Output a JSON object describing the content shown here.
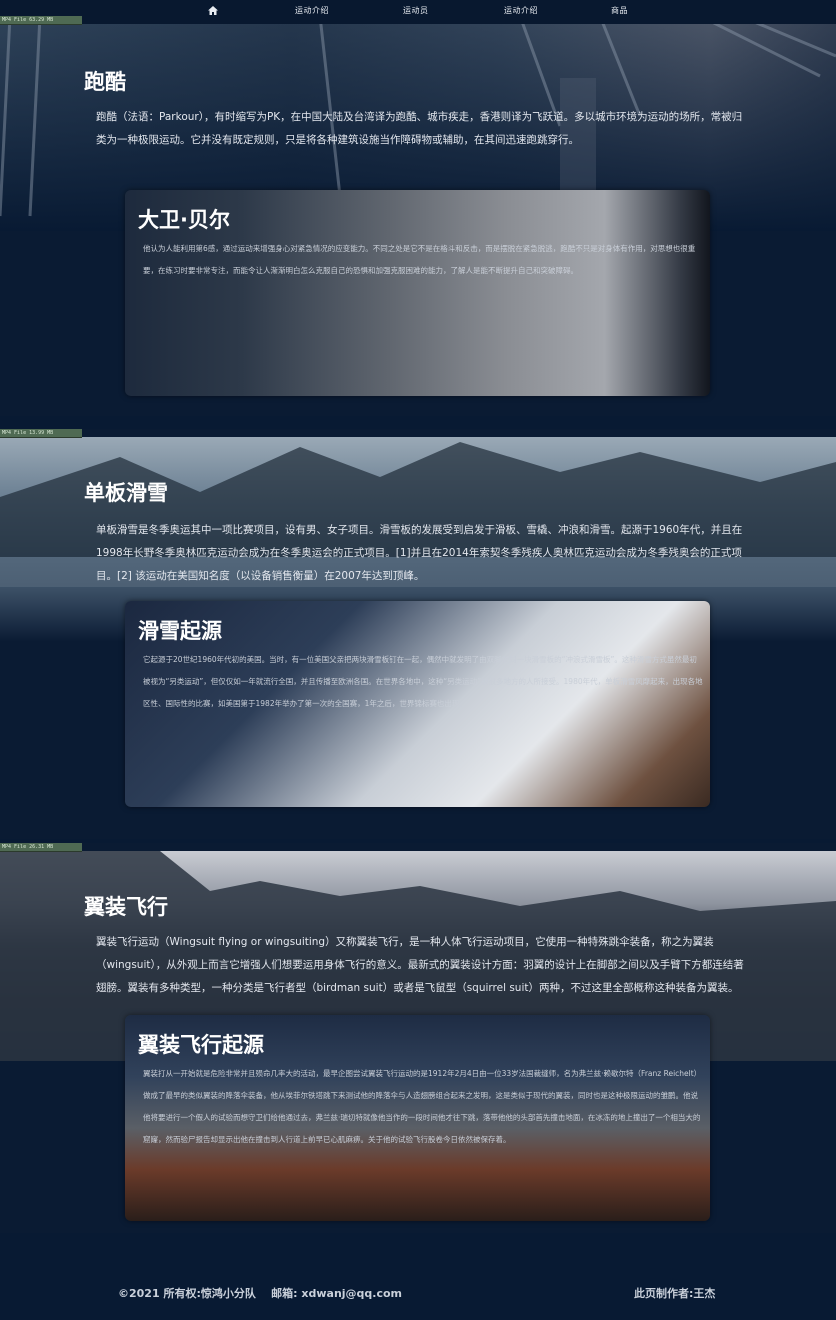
{
  "nav": {
    "items": [
      "运动介绍",
      "运动员",
      "运动介绍",
      "商品"
    ]
  },
  "file_tags": [
    "MP4 File 63.29 MB",
    "MP4 File 13.99 MB",
    "MP4 File 26.31 MB"
  ],
  "sections": [
    {
      "title": "跑酷",
      "text": "跑酷（法语：Parkour），有时缩写为PK，在中国大陆及台湾译为跑酷、城市疾走，香港则译为飞跃道。多以城市环境为运动的场所，常被归类为一种极限运动。它并没有既定规则，只是将各种建筑设施当作障碍物或辅助，在其间迅速跑跳穿行。",
      "card": {
        "title": "大卫·贝尔",
        "text": "他认为人能利用第6感，通过运动来增强身心对紧急情况的应变能力。不同之处是它不是在格斗和反击，而是摆脱在紧急脱逃，跑酷不只是对身体有作用，对思想也很重要，在练习时要非常专注，而能令让人渐渐明白怎么克服自己的恐惧和加强克服困难的能力，了解人是能不断提升自己和突破障碍。"
      }
    },
    {
      "title": "单板滑雪",
      "text": "单板滑雪是冬季奥运其中一项比赛项目，设有男、女子项目。滑雪板的发展受到启发于滑板、雪橇、冲浪和滑雪。起源于1960年代，并且在1998年长野冬季奥林匹克运动会成为在冬季奥运会的正式项目。[1]并且在2014年索契冬季残疾人奥林匹克运动会成为冬季残奥会的正式项目。[2] 该运动在美国知名度（以设备销售衡量）在2007年达到顶峰。",
      "card": {
        "title": "滑雪起源",
        "text": "它起源于20世纪1960年代初的美国。当时，有一位美国父亲把两块滑雪板钉在一起，偶然中就发明了由双脚在同一块滑雪板的“冲浪式滑雪板”。这种滑雪方式虽然最初被视为“另类运动”，但仅仅如一年就流行全国，并且传播至欧洲各国。在世界各地中，这种“另类运动”被很多地方的人所接受。1980年代，单板滑雪风靡起来，出现各地区性、国际性的比赛，如美国第于1982年举办了第一次的全国赛，1年之后，世界锦标赛也出现。"
      }
    },
    {
      "title": "翼装飞行",
      "text": "翼装飞行运动（Wingsuit flying or wingsuiting）又称翼装飞行，是一种人体飞行运动项目，它使用一种特殊跳伞装备，称之为翼装（wingsuit），从外观上而言它增强人们想要运用身体飞行的意义。最新式的翼装设计方面：羽翼的设计上在脚部之间以及手臂下方都连结著翅膀。翼装有多种类型，一种分类是飞行者型（birdman suit）或者是飞鼠型（squirrel suit）两种，不过这里全部概称这种装备为翼装。",
      "card": {
        "title": "翼装飞行起源",
        "text": "翼装打从一开始就是危险非常并且殒命几率大的活动，最早企图尝试翼装飞行运动的是1912年2月4日由一位33岁法国裁缝师，名为弗兰兹·赖歇尔特（Franz Reichelt）做成了最早的类似翼装的降落伞装备，他从埃菲尔铁塔跳下来测试他的降落伞与人造翅膀组合起来之发明，这是类似于现代的翼装，同时也是这种极限运动的雏鹏。他说他将要进行一个假人的试验而想守卫们给他通过去，弗兰兹·瑞切特就像他当作的一段时间他才往下跳，落带他他的头部首先撞击地面，在冰冻的地上撞出了一个相当大的窟窿，然而验尸报告却显示出他在撞击到人行道上前早已心肌麻痹。关于他的试验飞行股卷今日依然被保存着。"
      }
    }
  ],
  "footer": {
    "left": "©2021 所有权:惊鸿小分队    邮箱: xdwanj@qq.com",
    "right": "此页制作者:王杰"
  }
}
